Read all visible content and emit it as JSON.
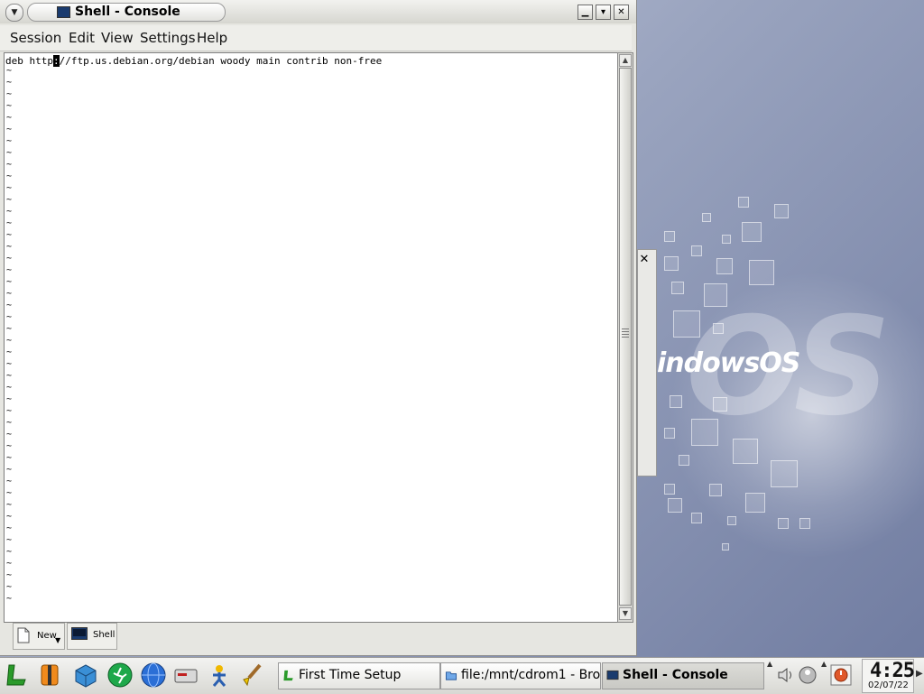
{
  "window": {
    "title": "Shell - Console",
    "menu": [
      "Session",
      "Edit",
      "View",
      "Settings",
      "Help"
    ]
  },
  "terminal": {
    "line1_before": "deb http",
    "line1_cursor": ":",
    "line1_after": "//ftp.us.debian.org/debian woody main contrib non-free",
    "tilde": "~"
  },
  "session_tabs": {
    "new_label": "New",
    "shell_label": "Shell"
  },
  "desktop": {
    "logo_text": "indowsOS",
    "big_text": "OS"
  },
  "taskbar": {
    "quick_launch": [
      "lindows-icon",
      "lifejacket-icon",
      "box-icon",
      "runner-icon",
      "globe-icon",
      "drive-icon",
      "person-icon",
      "brush-icon"
    ],
    "tasks": [
      {
        "label": "First Time Setup",
        "icon": "setup-icon",
        "active": false
      },
      {
        "label": "file:/mnt/cdrom1 - Brow",
        "icon": "folder-icon",
        "active": false
      },
      {
        "label": "Shell - Console",
        "icon": "terminal-icon",
        "active": true
      }
    ],
    "clock_time": "4:25",
    "clock_date": "02/07/22"
  },
  "colors": {
    "desktop_bg": "#9aa4bf",
    "terminal_bg": "#ffffff",
    "window_chrome": "#e6e6e1"
  }
}
